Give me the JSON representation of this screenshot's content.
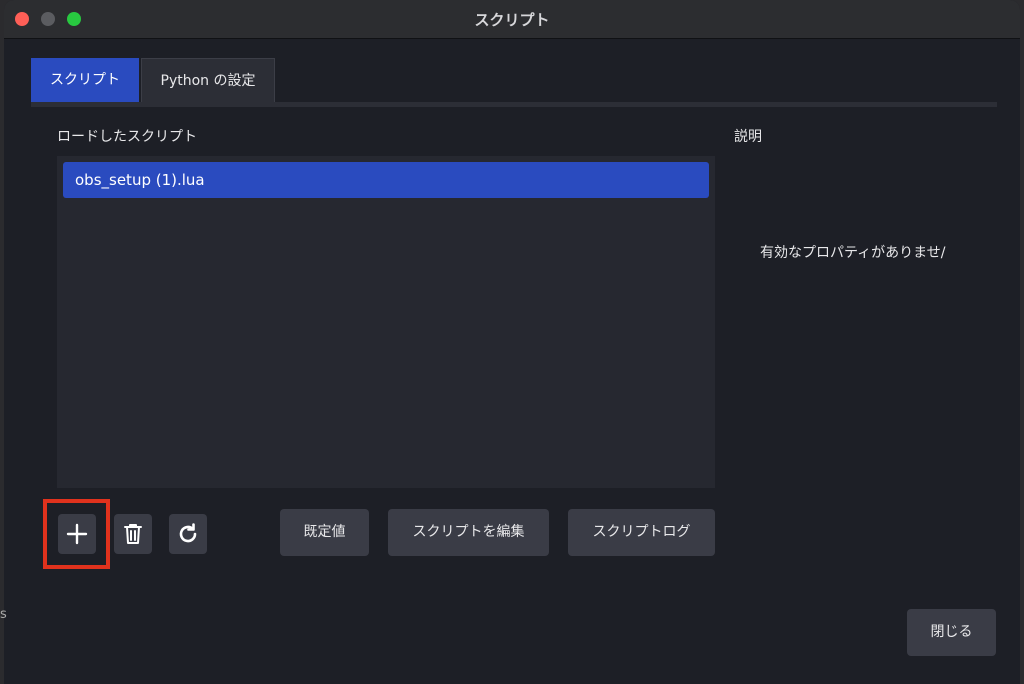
{
  "window": {
    "title": "スクリプト"
  },
  "tabs": [
    {
      "label": "スクリプト",
      "active": true
    },
    {
      "label": "Python の設定",
      "active": false
    }
  ],
  "scripts": {
    "heading": "ロードしたスクリプト",
    "items": [
      "obs_setup (1).lua"
    ],
    "selected_index": 0
  },
  "description": {
    "heading": "説明",
    "text": "有効なプロパティがありませ/"
  },
  "toolbar": {
    "add_icon": "plus-icon",
    "remove_icon": "trash-icon",
    "reload_icon": "reload-icon",
    "defaults_label": "既定値",
    "edit_label": "スクリプトを編集",
    "log_label": "スクリプトログ"
  },
  "footer": {
    "close_label": "閉じる"
  },
  "edge_text": "s",
  "colors": {
    "accent": "#2a4bbf",
    "highlight": "#e0321d",
    "background": "#1d1f26"
  }
}
